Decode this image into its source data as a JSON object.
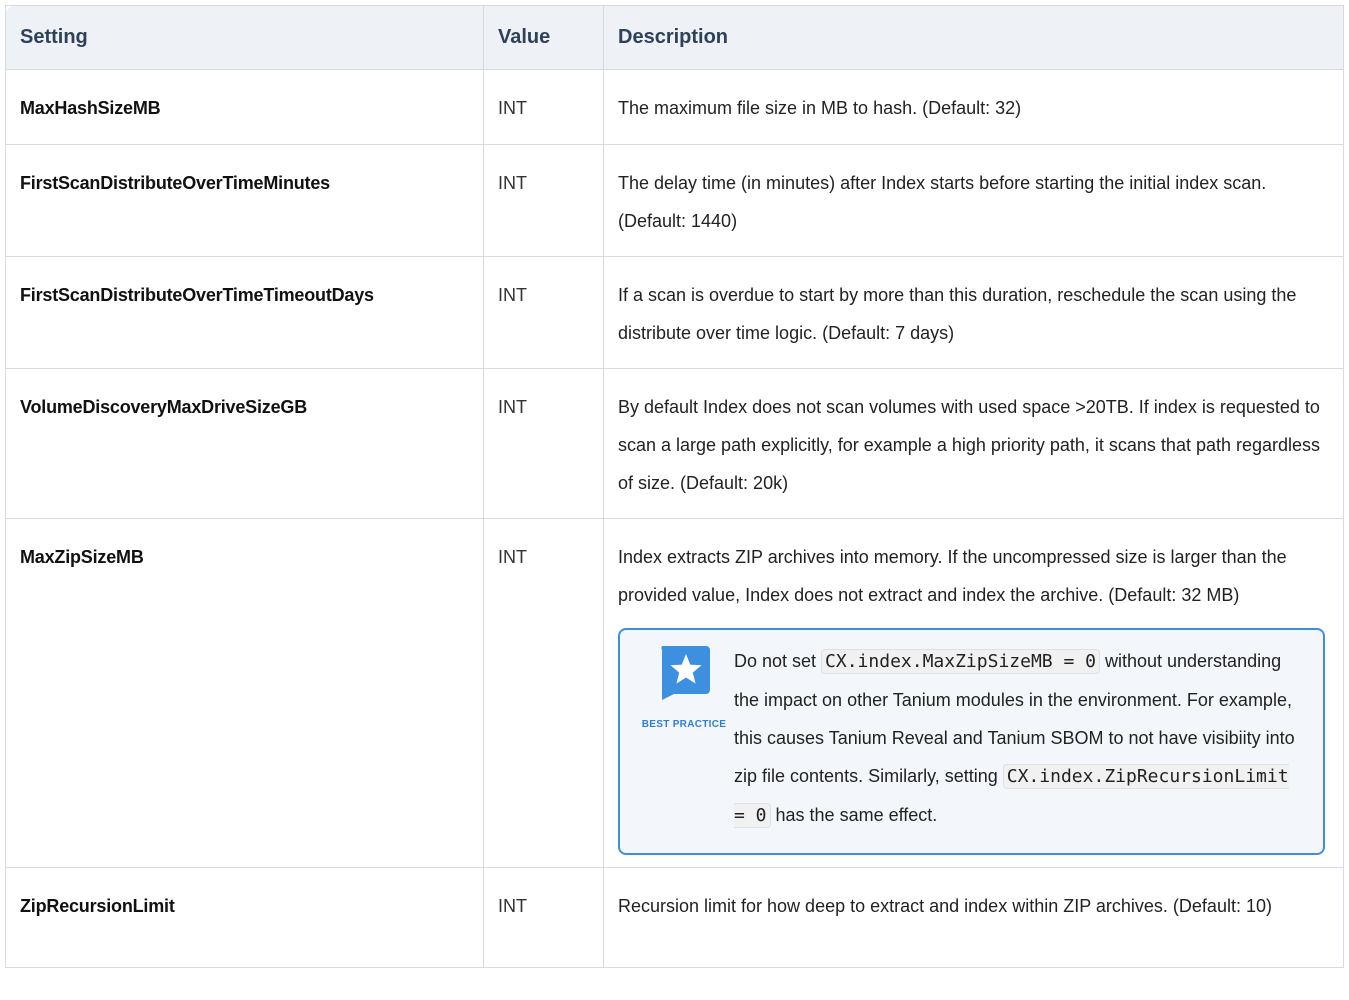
{
  "table": {
    "headers": [
      "Setting",
      "Value",
      "Description"
    ],
    "rows": [
      {
        "setting": "MaxHashSizeMB",
        "value": "INT",
        "description": "The maximum file size in MB to hash. (Default: 32)"
      },
      {
        "setting": "FirstScanDistributeOverTimeMinutes",
        "value": "INT",
        "description": "The delay time (in minutes) after Index starts before starting the initial index scan. (Default: 1440)"
      },
      {
        "setting": "FirstScanDistributeOverTimeTimeoutDays",
        "value": "INT",
        "description": "If a scan is overdue to start by more than this duration, reschedule the scan using the distribute over time logic. (Default: 7 days)"
      },
      {
        "setting": "VolumeDiscoveryMaxDriveSizeGB",
        "value": "INT",
        "description": "By default Index does not scan volumes with used space >20TB. If index is requested to scan a large path explicitly, for example a high priority path, it scans that path regardless of size. (Default: 20k)"
      },
      {
        "setting": "MaxZipSizeMB",
        "value": "INT",
        "description": "Index extracts ZIP archives into memory. If the uncompressed size is larger than the provided value, Index does not extract and index the archive. (Default: 32 MB)"
      },
      {
        "setting": "ZipRecursionLimit",
        "value": "INT",
        "description": "Recursion limit for how deep to extract and index within ZIP archives. (Default: 10)"
      }
    ]
  },
  "callout": {
    "icon": "star-speech-bubble-icon",
    "label": "BEST PRACTICE",
    "text_1": "Do not set ",
    "code_1": "CX.index.MaxZipSizeMB = 0",
    "text_2": " without understanding the impact on other Tanium modules in the environment. For example, this causes Tanium Reveal and Tanium SBOM to not have visibiity into zip file contents. Similarly, setting ",
    "code_2": "CX.index.ZipRecursionLimit = 0",
    "text_3": " has the same effect.",
    "accent_color": "#3d8fe0"
  },
  "colors": {
    "header_bg": "#eef1f5",
    "header_text": "#2f4159",
    "border": "#d6dbe3"
  }
}
